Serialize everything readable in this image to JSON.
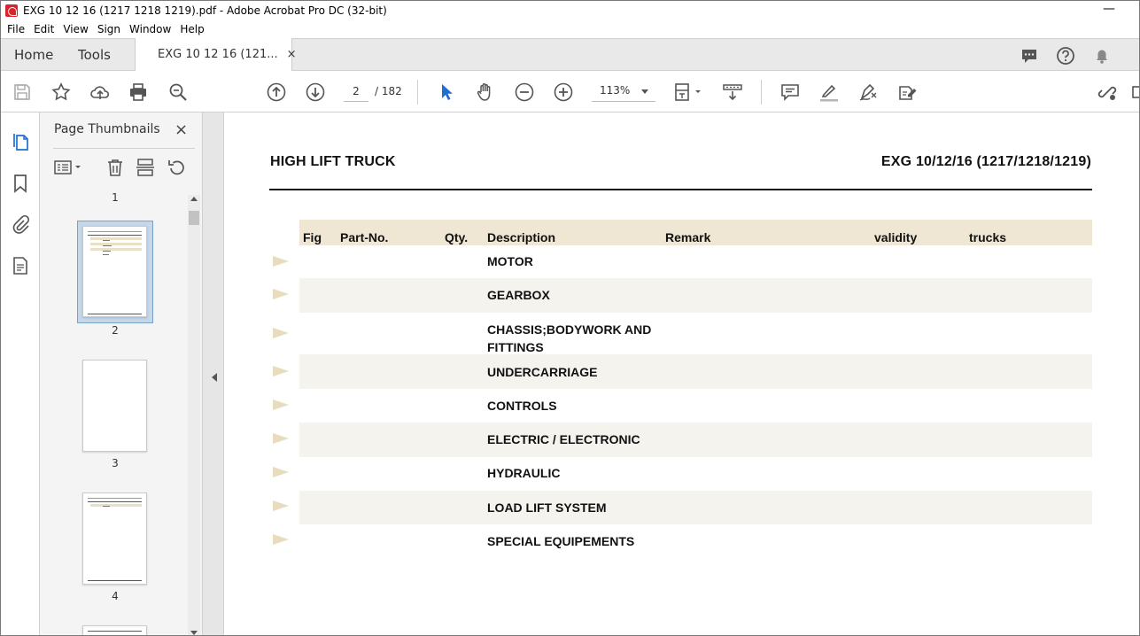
{
  "window": {
    "title": "EXG 10 12 16 (1217 1218 1219).pdf - Adobe Acrobat Pro DC (32-bit)",
    "minimize_glyph": "—"
  },
  "menu": [
    "File",
    "Edit",
    "View",
    "Sign",
    "Window",
    "Help"
  ],
  "tabs": {
    "home": "Home",
    "tools": "Tools",
    "document": "EXG 10 12 16 (121...",
    "close_glyph": "×"
  },
  "toolbar": {
    "current_page": "2",
    "page_total": "/ 182",
    "zoom": "113%"
  },
  "thumbnail_panel": {
    "title": "Page Thumbnails",
    "close_glyph": "×",
    "thumbnails": [
      {
        "page": "1"
      },
      {
        "page": "2",
        "selected": true
      },
      {
        "page": "3"
      },
      {
        "page": "4"
      }
    ]
  },
  "document": {
    "header_left": "HIGH LIFT TRUCK",
    "header_right": "EXG 10/12/16 (1217/1218/1219)",
    "columns": {
      "fig": "Fig",
      "part_no": "Part-No.",
      "qty": "Qty.",
      "description": "Description",
      "remark": "Remark",
      "validity": "validity",
      "trucks": "trucks"
    },
    "rows": [
      {
        "description": "MOTOR"
      },
      {
        "description": "GEARBOX"
      },
      {
        "description": "CHASSIS;BODYWORK AND FITTINGS"
      },
      {
        "description": "UNDERCARRIAGE"
      },
      {
        "description": "CONTROLS"
      },
      {
        "description": "ELECTRIC / ELECTRONIC"
      },
      {
        "description": "HYDRAULIC"
      },
      {
        "description": "LOAD LIFT SYSTEM"
      },
      {
        "description": "SPECIAL EQUIPEMENTS"
      }
    ]
  },
  "colors": {
    "accent_blue": "#1f6fd1",
    "header_beige": "#efe6d3",
    "row_shade": "#f4f3ee",
    "arrow_tan": "#e8dcbf",
    "selection_blue": "#c5d7e8"
  }
}
